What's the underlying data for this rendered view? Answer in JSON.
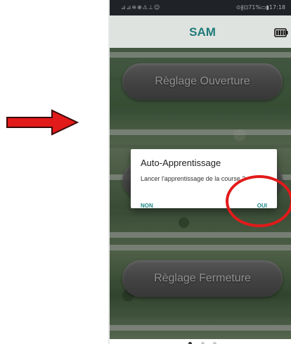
{
  "status_bar": {
    "left_icons": "⊿⊿≋⊕⚠⊥☺",
    "right_text": "⊙∦⊡71%▭▮17:18"
  },
  "app_bar": {
    "title": "SAM",
    "battery_icon": "battery-icon"
  },
  "main": {
    "button_ouverture": "Règlage Ouverture",
    "button_fermeture": "Règlage Fermeture"
  },
  "dialog": {
    "title": "Auto-Apprentissage",
    "message": "Lancer l'apprentissage de la course ?",
    "negative_label": "NON",
    "positive_label": "OUI"
  },
  "annotations": {
    "arrow_color": "#e21a1a",
    "circle_color": "#e21a1a"
  },
  "pager": {
    "pages": 3,
    "active_index": 0
  },
  "colors": {
    "accent": "#1f8a86",
    "title": "#1f7a7a",
    "status_bar": "#2a2e34"
  }
}
